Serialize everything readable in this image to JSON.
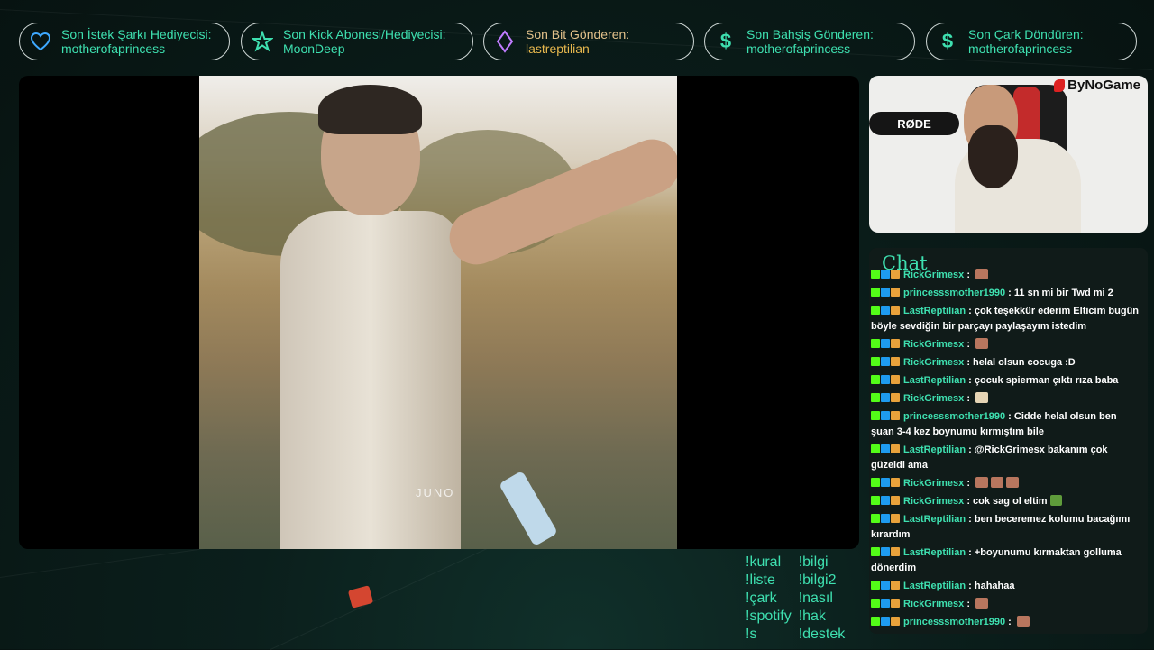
{
  "alerts": [
    {
      "title": "Son İstek Şarkı Hediyecisi:",
      "user": "motherofaprincess",
      "icon": "heart-icon"
    },
    {
      "title": "Son Kick Abonesi/Hediyecisi:",
      "user": "MoonDeep",
      "icon": "star-icon"
    },
    {
      "title": "Son Bit Gönderen:",
      "user": "lastreptilian",
      "icon": "diamond-icon"
    },
    {
      "title": "Son Bahşiş Gönderen:",
      "user": "motherofaprincess",
      "icon": "dollar-icon"
    },
    {
      "title": "Son Çark Döndüren:",
      "user": "motherofaprincess",
      "icon": "dollar-icon"
    }
  ],
  "video": {
    "watermark": "JUNO"
  },
  "webcam": {
    "brand": "ByNoGame",
    "mic_label": "RØDE"
  },
  "chat": {
    "title": "Chat",
    "messages": [
      {
        "user": "RickGrimesx",
        "text": " : ",
        "emotes": 1
      },
      {
        "user": "princesssmother1990",
        "text": " : 11 sn mi bir Twd mi 2",
        "emotes": 0
      },
      {
        "user": "LastReptilian",
        "text": " : çok teşekkür ederim Elticim bugün böyle sevdiğin bir parçayı paylaşayım istedim",
        "emotes": 0
      },
      {
        "user": "RickGrimesx",
        "text": " : ",
        "emotes": 1
      },
      {
        "user": "RickGrimesx",
        "text": " : helal olsun cocuga :D",
        "emotes": 0
      },
      {
        "user": "LastReptilian",
        "text": " : çocuk spierman çıktı rıza baba",
        "emotes": 0
      },
      {
        "user": "RickGrimesx",
        "text": " : ",
        "emotes": 1,
        "emote_style": "light"
      },
      {
        "user": "princesssmother1990",
        "text": " : Cidde helal olsun ben şuan 3-4 kez boynumu kırmıştım bile",
        "emotes": 0
      },
      {
        "user": "LastReptilian",
        "text": " : @RickGrimesx bakanım çok güzeldi ama",
        "emotes": 0
      },
      {
        "user": "RickGrimesx",
        "text": " : ",
        "emotes": 3
      },
      {
        "user": "RickGrimesx",
        "text": " : cok sag ol eltim",
        "emotes": 1,
        "emote_style": "frog"
      },
      {
        "user": "LastReptilian",
        "text": " : ben beceremez kolumu bacağımı kırardım",
        "emotes": 0
      },
      {
        "user": "LastReptilian",
        "text": " : +boyunumu kırmaktan golluma dönerdim",
        "emotes": 0
      },
      {
        "user": "LastReptilian",
        "text": " : hahahaa",
        "emotes": 0
      },
      {
        "user": "RickGrimesx",
        "text": " : ",
        "emotes": 1
      },
      {
        "user": "princesssmother1990",
        "text": " : ",
        "emotes": 1
      }
    ]
  },
  "commands": {
    "col1": [
      "!kural",
      "!liste",
      "!çark",
      "!spotify",
      "!s"
    ],
    "col2": [
      "!bilgi",
      "!bilgi2",
      "!nasıl",
      "!hak",
      "!destek"
    ]
  },
  "colors": {
    "accent": "#3ee0b0",
    "background": "#0b1f1c",
    "bits_user": "#e7b84e"
  }
}
